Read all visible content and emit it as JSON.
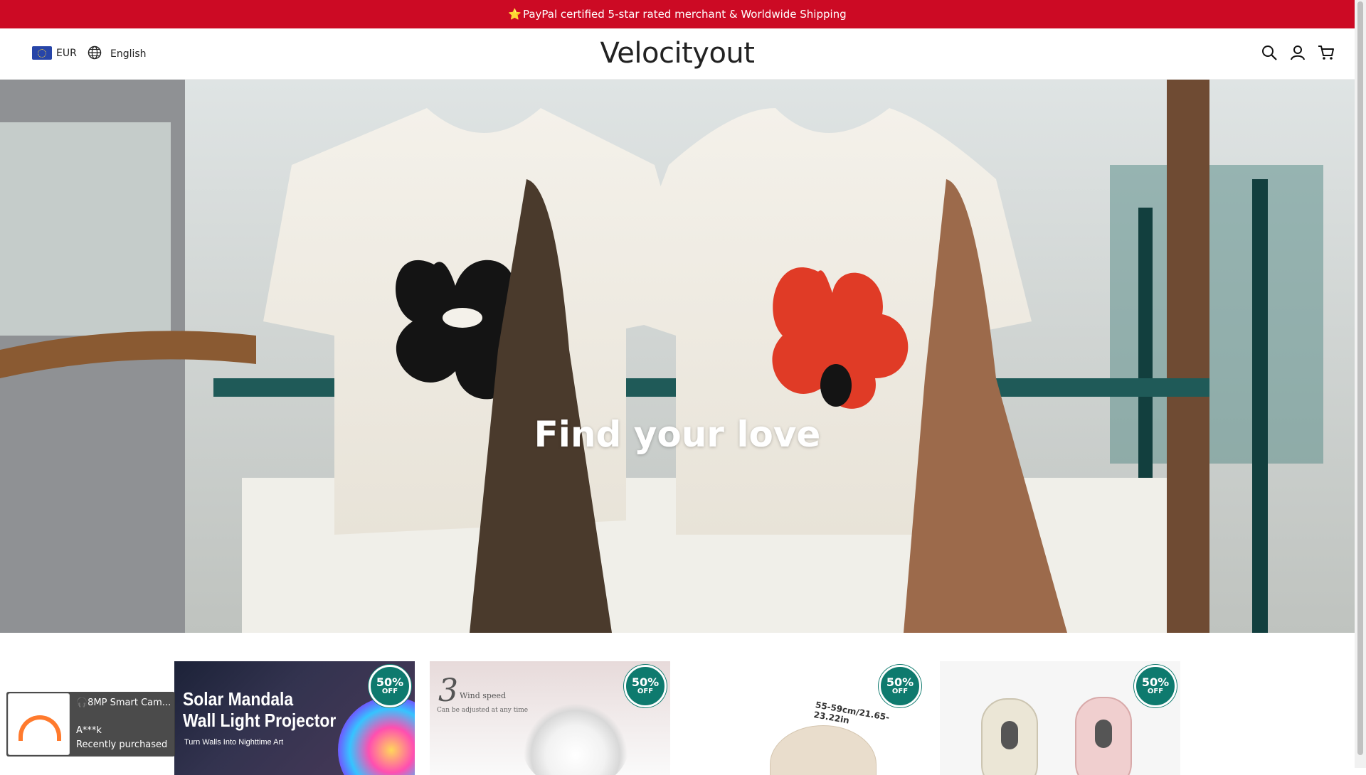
{
  "announcement": {
    "star": "⭐",
    "text": "PayPal certified 5-star rated merchant & Worldwide Shipping"
  },
  "header": {
    "currency": "EUR",
    "language": "English",
    "logo": "Velocityout",
    "icons": [
      "search-icon",
      "account-icon",
      "cart-icon"
    ]
  },
  "hero": {
    "title": "Find your love"
  },
  "products": [
    {
      "badge_pct": "50%",
      "badge_off": "OFF",
      "title_line1": "Solar Mandala",
      "title_line2": "Wall Light Projector",
      "tagline": "Turn Walls Into Nighttime Art"
    },
    {
      "badge_pct": "50%",
      "badge_off": "OFF",
      "number": "3",
      "wind_speed": "Wind speed",
      "adjust": "Can be adjusted at any time"
    },
    {
      "badge_pct": "50%",
      "badge_off": "OFF",
      "dimension": "55-59cm/21.65-23.22in"
    },
    {
      "badge_pct": "50%",
      "badge_off": "OFF"
    }
  ],
  "toast": {
    "product": "🎧8MP Smart Cam...",
    "buyer": "A***k",
    "status": "Recently purchased"
  },
  "colors": {
    "announcement_bg": "#cc0a24",
    "badge": "#0e7a6e"
  }
}
